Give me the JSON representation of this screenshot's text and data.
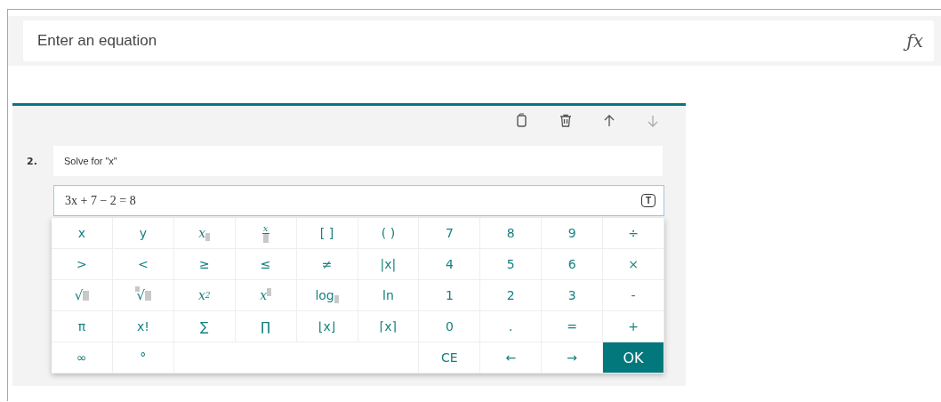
{
  "equation_bar": {
    "placeholder": "Enter an equation",
    "function_button": "ƒx"
  },
  "question": {
    "number": "2.",
    "toolbar": [
      {
        "kind": "copy",
        "disabled": false
      },
      {
        "kind": "delete",
        "disabled": false
      },
      {
        "kind": "up",
        "disabled": false
      },
      {
        "kind": "down",
        "disabled": true
      }
    ],
    "title": "Solve for \"x\"",
    "answer": "3x + 7 − 2 = 8",
    "mode_toggle": "T"
  },
  "keypad": [
    [
      {
        "kind": "text",
        "label": "x"
      },
      {
        "kind": "text",
        "label": "y"
      },
      {
        "kind": "subscript",
        "label": "x"
      },
      {
        "kind": "fraction",
        "label": "x"
      },
      {
        "kind": "text",
        "label": "[ ]"
      },
      {
        "kind": "text",
        "label": "( )"
      },
      {
        "kind": "text",
        "label": "7"
      },
      {
        "kind": "text",
        "label": "8"
      },
      {
        "kind": "text",
        "label": "9"
      },
      {
        "kind": "text",
        "label": "÷"
      }
    ],
    [
      {
        "kind": "text",
        "label": ">"
      },
      {
        "kind": "text",
        "label": "<"
      },
      {
        "kind": "text",
        "label": "≥"
      },
      {
        "kind": "text",
        "label": "≤"
      },
      {
        "kind": "text",
        "label": "≠"
      },
      {
        "kind": "text",
        "label": "|x|"
      },
      {
        "kind": "text",
        "label": "4"
      },
      {
        "kind": "text",
        "label": "5"
      },
      {
        "kind": "text",
        "label": "6"
      },
      {
        "kind": "text",
        "label": "×"
      }
    ],
    [
      {
        "kind": "sqrt",
        "label": "√"
      },
      {
        "kind": "root",
        "label": "√"
      },
      {
        "kind": "power",
        "label": "x",
        "exponent": "2"
      },
      {
        "kind": "superscript",
        "label": "x"
      },
      {
        "kind": "subscript",
        "label": "log"
      },
      {
        "kind": "text",
        "label": "ln"
      },
      {
        "kind": "text",
        "label": "1"
      },
      {
        "kind": "text",
        "label": "2"
      },
      {
        "kind": "text",
        "label": "3"
      },
      {
        "kind": "text",
        "label": "-"
      }
    ],
    [
      {
        "kind": "text",
        "label": "π"
      },
      {
        "kind": "text",
        "label": "x!"
      },
      {
        "kind": "text",
        "label": "∑"
      },
      {
        "kind": "text",
        "label": "∏"
      },
      {
        "kind": "text",
        "label": "⌊x⌋"
      },
      {
        "kind": "text",
        "label": "⌈x⌉"
      },
      {
        "kind": "text",
        "label": "0"
      },
      {
        "kind": "text",
        "label": "."
      },
      {
        "kind": "text",
        "label": "="
      },
      {
        "kind": "text",
        "label": "+"
      }
    ],
    [
      {
        "kind": "text",
        "label": "∞"
      },
      {
        "kind": "text",
        "label": "°"
      },
      {
        "kind": "blank"
      },
      {
        "kind": "text",
        "label": "CE"
      },
      {
        "kind": "text",
        "label": "←"
      },
      {
        "kind": "text",
        "label": "→"
      },
      {
        "kind": "primary",
        "label": "OK"
      }
    ]
  ]
}
